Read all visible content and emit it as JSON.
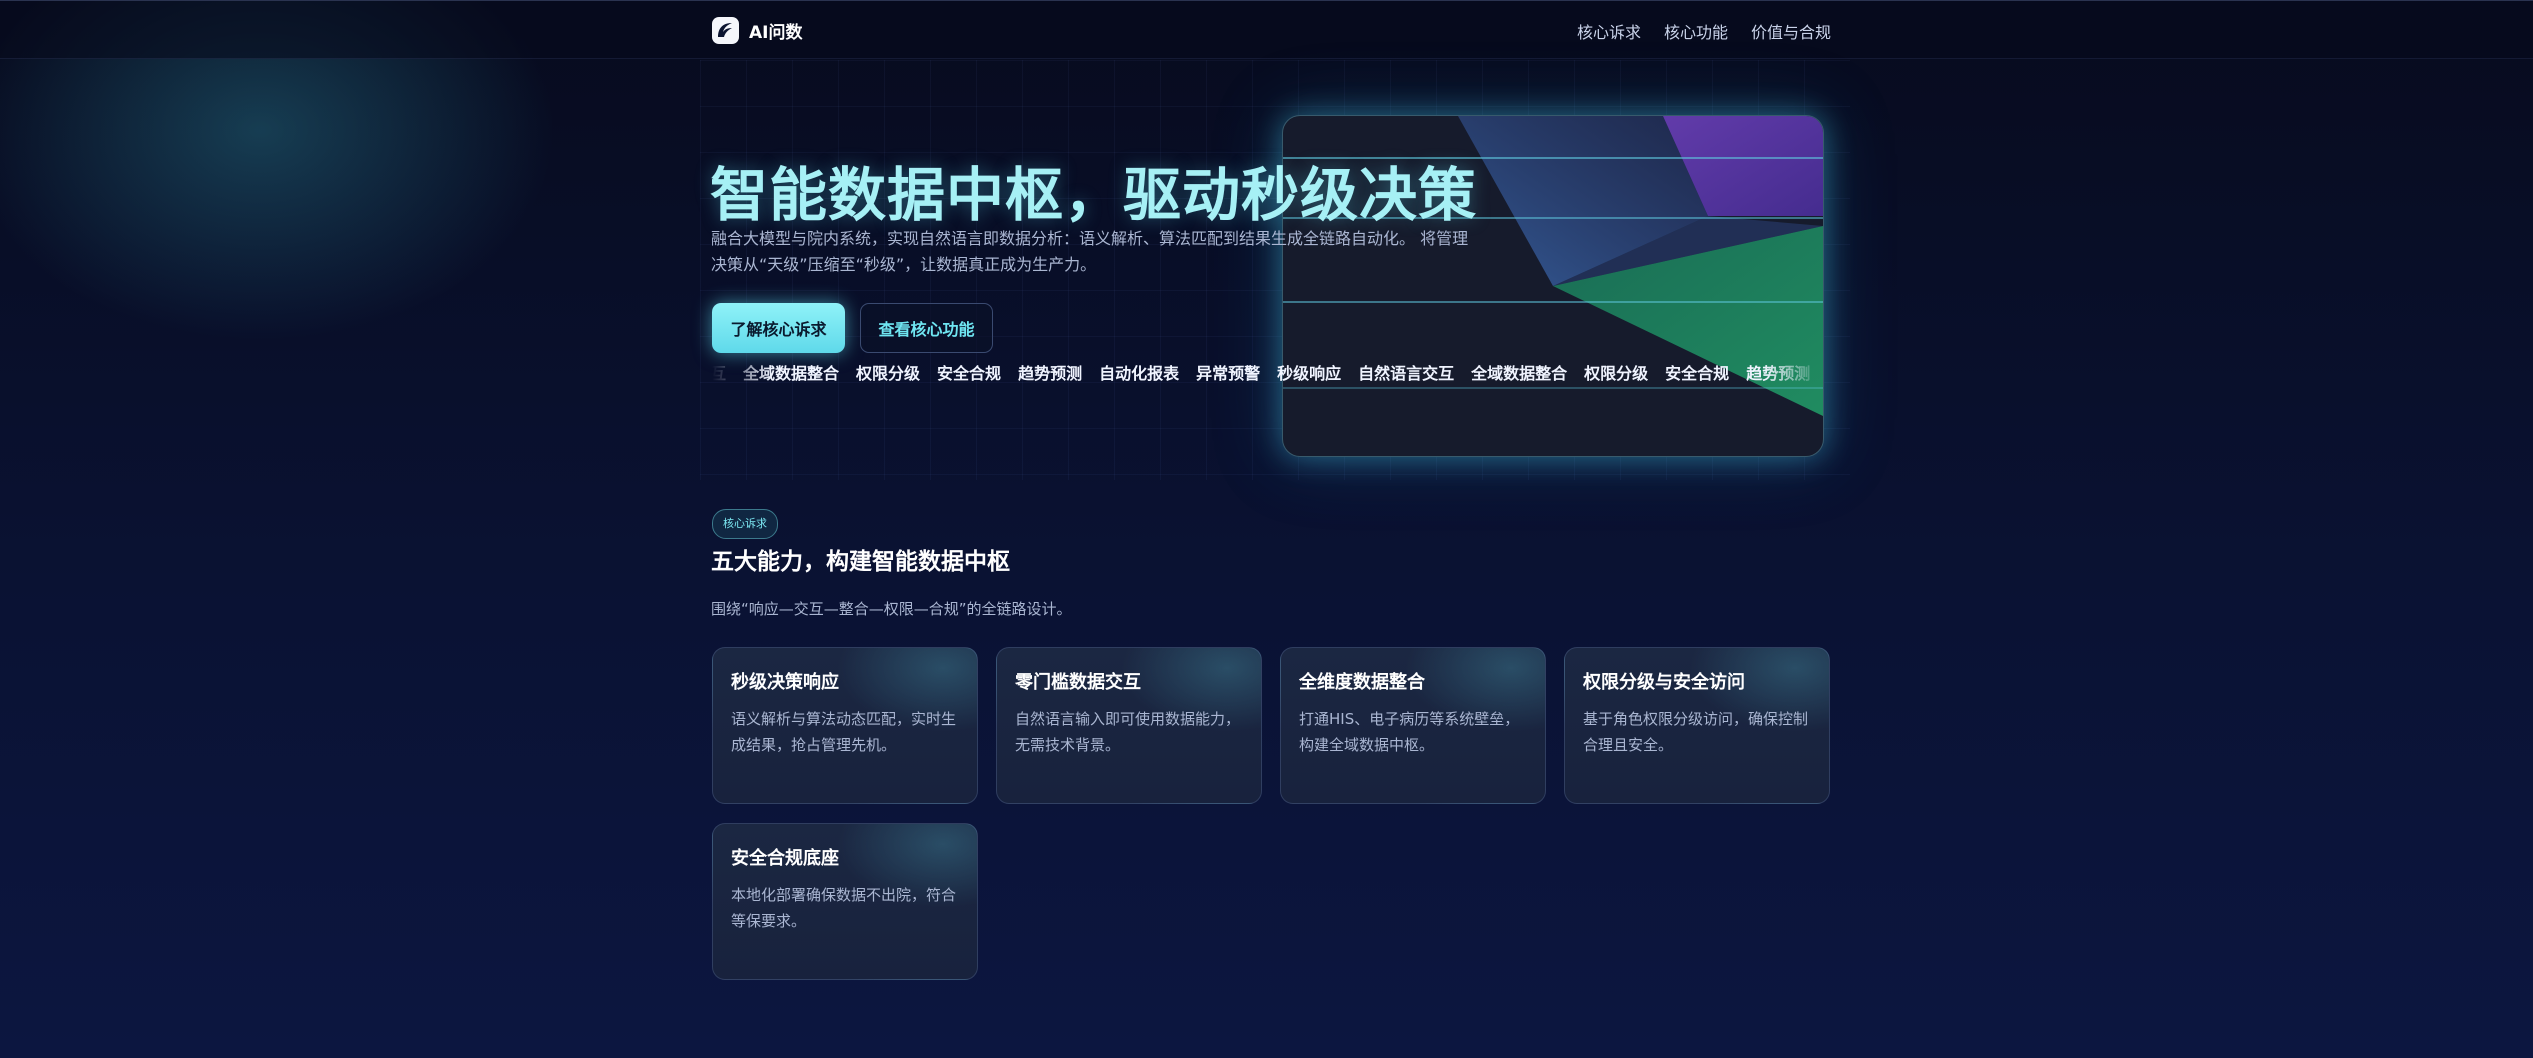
{
  "nav": {
    "brand": "AI问数",
    "links": [
      "核心诉求",
      "核心功能",
      "价值与合规"
    ]
  },
  "hero": {
    "title": "智能数据中枢，驱动秒级决策",
    "description": "融合大模型与院内系统，实现自然语言即数据分析：语义解析、算法匹配到结果生成全链路自动化。 将管理决策从“天级”压缩至“秒级”，让数据真正成为生产力。",
    "primary_button": "了解核心诉求",
    "secondary_button": "查看核心功能",
    "ticker": [
      "交互",
      "全域数据整合",
      "权限分级",
      "安全合规",
      "趋势预测",
      "自动化报表",
      "异常预警",
      "秒级响应",
      "自然语言交互",
      "全域数据整合",
      "权限分级",
      "安全合规",
      "趋势预测"
    ]
  },
  "section": {
    "badge": "核心诉求",
    "title": "五大能力，构建智能数据中枢",
    "description": "围绕“响应—交互—整合—权限—合规”的全链路设计。",
    "cards": [
      {
        "title": "秒级决策响应",
        "text": "语义解析与算法动态匹配，实时生成结果，抢占管理先机。"
      },
      {
        "title": "零门槛数据交互",
        "text": "自然语言输入即可使用数据能力，无需技术背景。"
      },
      {
        "title": "全维度数据整合",
        "text": "打通HIS、电子病历等系统壁垒，构建全域数据中枢。"
      },
      {
        "title": "权限分级与安全访问",
        "text": "基于角色权限分级访问，确保控制合理且安全。"
      },
      {
        "title": "安全合规底座",
        "text": "本地化部署确保数据不出院，符合等保要求。"
      }
    ]
  },
  "colors": {
    "accent": "#8ff2f8",
    "title_glow": "#a6f0f5",
    "background": "#0a1030"
  },
  "icons": {
    "logo": "brand-logo-icon"
  }
}
